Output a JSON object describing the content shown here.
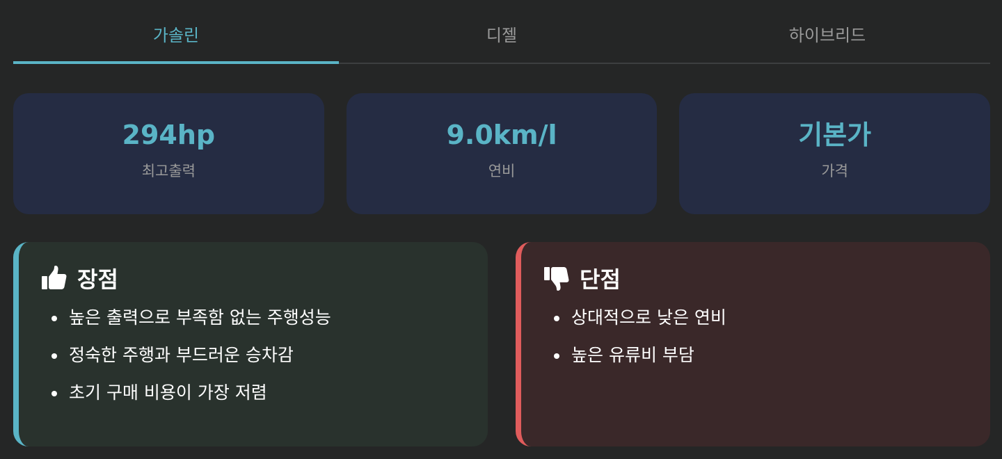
{
  "tabs": [
    {
      "label": "가솔린",
      "active": true
    },
    {
      "label": "디젤",
      "active": false
    },
    {
      "label": "하이브리드",
      "active": false
    }
  ],
  "stats": [
    {
      "value": "294hp",
      "label": "최고출력"
    },
    {
      "value": "9.0km/l",
      "label": "연비"
    },
    {
      "value": "기본가",
      "label": "가격"
    }
  ],
  "pros": {
    "title": "장점",
    "icon": "thumbs-up-icon",
    "items": [
      "높은 출력으로 부족함 없는 주행성능",
      "정숙한 주행과 부드러운 승차감",
      "초기 구매 비용이 가장 저렴"
    ]
  },
  "cons": {
    "title": "단점",
    "icon": "thumbs-down-icon",
    "items": [
      "상대적으로 낮은 연비",
      "높은 유류비 부담"
    ]
  },
  "colors": {
    "accent": "#5ab4c6",
    "negative": "#e05c5c",
    "background": "#252626",
    "card": "#252c43"
  }
}
